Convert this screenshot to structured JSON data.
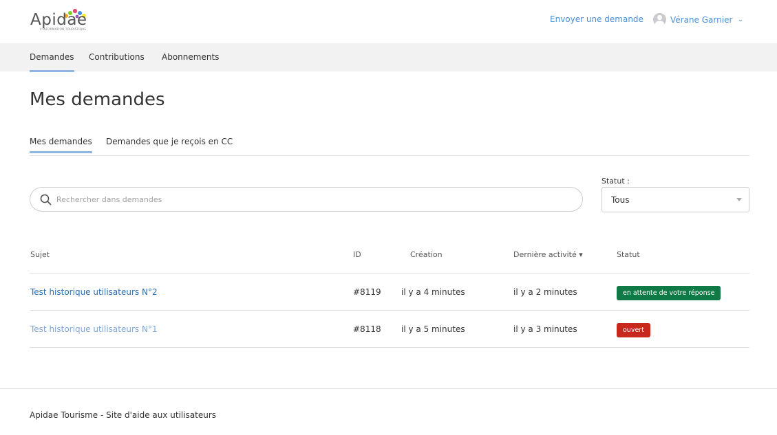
{
  "header": {
    "logo_text": "Apidae",
    "logo_subtext": "L'INFORMATION TOURISTIQUE",
    "send_request_label": "Envoyer une demande",
    "user_name": "Vérane Garnier",
    "chevron": "⌄"
  },
  "nav": {
    "items": [
      {
        "label": "Demandes"
      },
      {
        "label": "Contributions"
      },
      {
        "label": "Abonnements"
      }
    ]
  },
  "page": {
    "title": "Mes demandes"
  },
  "subtabs": [
    {
      "label": "Mes demandes"
    },
    {
      "label": "Demandes que je reçois en CC"
    }
  ],
  "search": {
    "placeholder": "Rechercher dans demandes",
    "value": ""
  },
  "status_filter": {
    "label": "Statut :",
    "selected": "Tous"
  },
  "table": {
    "headers": {
      "subject": "Sujet",
      "id": "ID",
      "created": "Création",
      "last_activity": "Dernière activité ▾",
      "status": "Statut"
    },
    "rows": [
      {
        "subject": "Test historique utilisateurs N°2",
        "id": "#8119",
        "created": "il y a 4 minutes",
        "last_activity": "il y a 2 minutes",
        "status": "en attente de votre réponse",
        "status_color": "#0f7a45"
      },
      {
        "subject": "Test historique utilisateurs N°1",
        "id": "#8118",
        "created": "il y a 5 minutes",
        "last_activity": "il y a 3 minutes",
        "status": "ouvert",
        "status_color": "#c8271c"
      }
    ]
  },
  "footer": {
    "text": "Apidae Tourisme - Site d'aide aux utilisateurs"
  },
  "colors": {
    "link": "#4a90d9",
    "active_tab_underline": "#8fb6e2",
    "nav_bg": "#f2f2f2"
  }
}
